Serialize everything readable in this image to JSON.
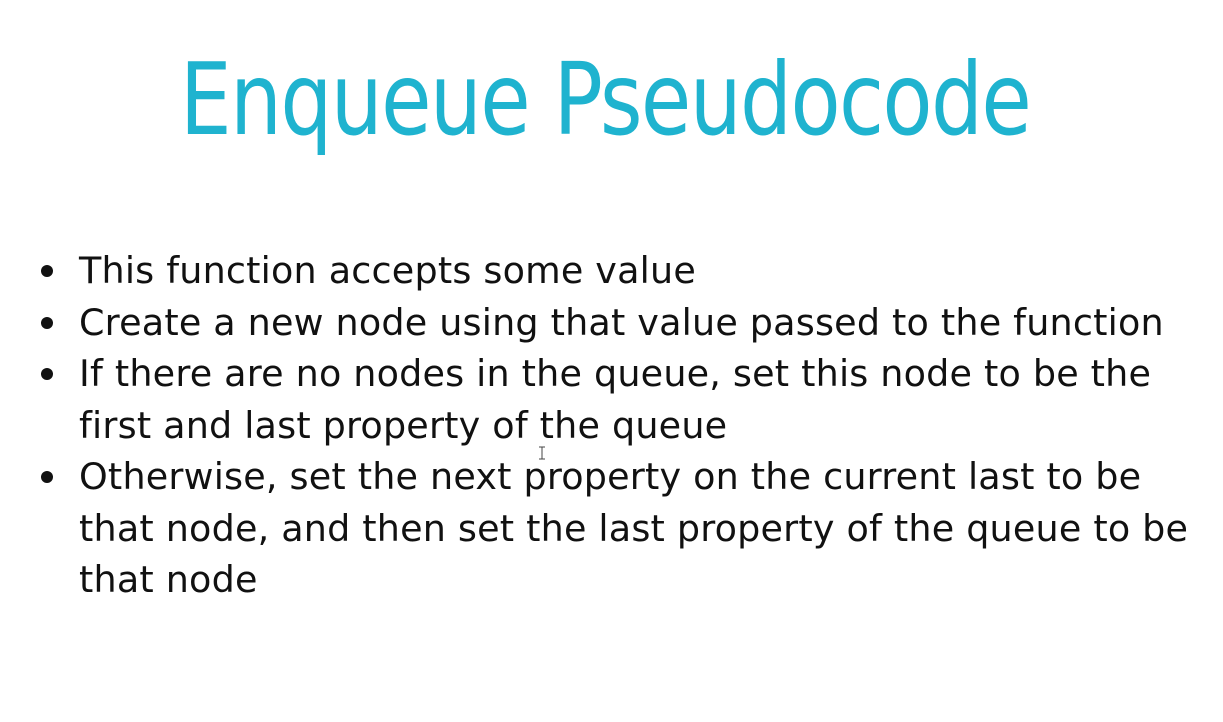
{
  "slide": {
    "title": "Enqueue Pseudocode",
    "title_color": "#1fb3cf",
    "bullets": [
      "This function accepts some value",
      "Create a new node using that value passed to the function",
      "If there are no nodes in the queue, set this node to be the first and last property of the queue",
      "Otherwise, set the next property on the current last to be that node, and then set the last property of the queue to be that node"
    ]
  },
  "cursor": {
    "icon": "text-cursor-icon"
  }
}
